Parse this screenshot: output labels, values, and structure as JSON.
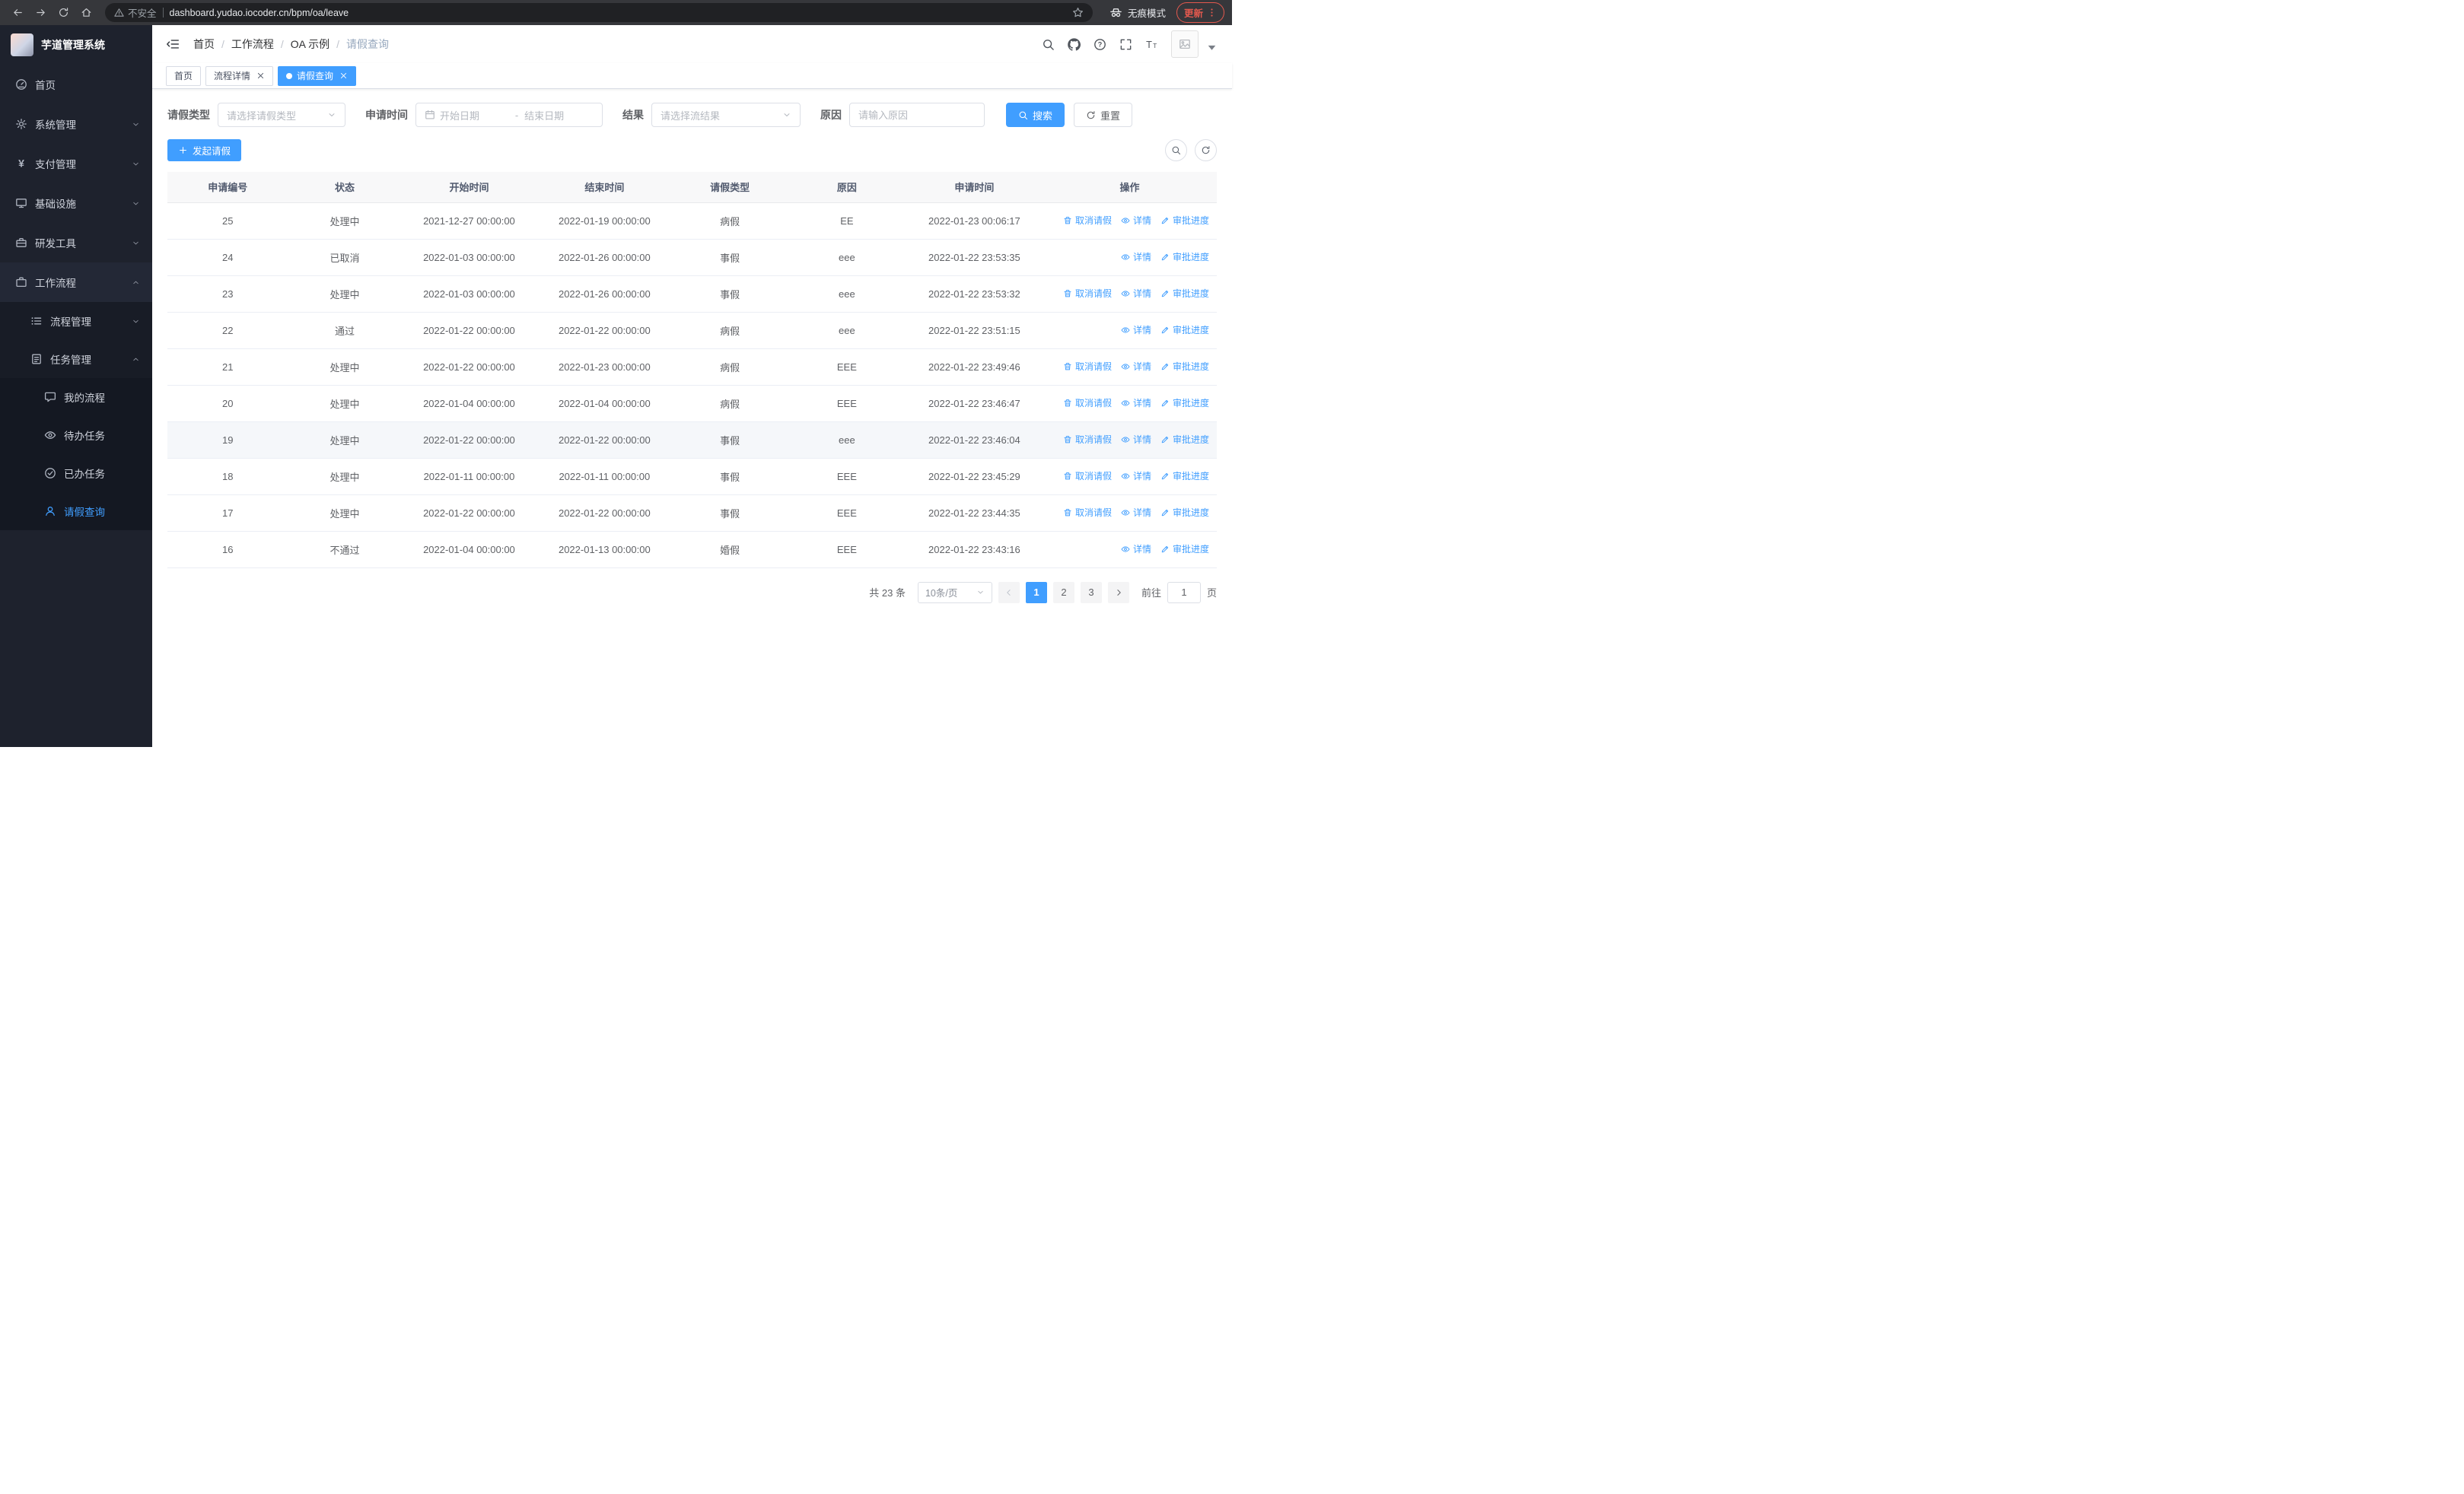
{
  "browser": {
    "security_label": "不安全",
    "url": "dashboard.yudao.iocoder.cn/bpm/oa/leave",
    "incognito_label": "无痕模式",
    "update_label": "更新"
  },
  "sidebar": {
    "logo_title": "芋道管理系统",
    "menu": [
      {
        "key": "home",
        "icon": "dashboard",
        "label": "首页",
        "level": 1
      },
      {
        "key": "system-management",
        "icon": "gear",
        "label": "系统管理",
        "level": 1,
        "arrow": "down"
      },
      {
        "key": "payment-management",
        "icon": "yen",
        "label": "支付管理",
        "level": 1,
        "arrow": "down"
      },
      {
        "key": "infrastructure",
        "icon": "monitor",
        "label": "基础设施",
        "level": 1,
        "arrow": "down"
      },
      {
        "key": "dev-tools",
        "icon": "toolbox",
        "label": "研发工具",
        "level": 1,
        "arrow": "down"
      },
      {
        "key": "workflow",
        "icon": "suitcase",
        "label": "工作流程",
        "level": 1,
        "arrow": "up",
        "parent_active": true
      },
      {
        "key": "process-management",
        "icon": "list",
        "label": "流程管理",
        "level": 2,
        "arrow": "down"
      },
      {
        "key": "task-management",
        "icon": "tasks",
        "label": "任务管理",
        "level": 2,
        "arrow": "up"
      },
      {
        "key": "my-process",
        "icon": "chat",
        "label": "我的流程",
        "level": 3
      },
      {
        "key": "todo-tasks",
        "icon": "eye",
        "label": "待办任务",
        "level": 3
      },
      {
        "key": "done-tasks",
        "icon": "check",
        "label": "已办任务",
        "level": 3
      },
      {
        "key": "leave-query",
        "icon": "user",
        "label": "请假查询",
        "level": 3,
        "active": true
      }
    ]
  },
  "breadcrumb": {
    "separator": "/",
    "items": [
      "首页",
      "工作流程",
      "OA 示例",
      "请假查询"
    ]
  },
  "tabs": [
    {
      "label": "首页",
      "closable": false,
      "active": false
    },
    {
      "label": "流程详情",
      "closable": true,
      "active": false
    },
    {
      "label": "请假查询",
      "closable": true,
      "active": true
    }
  ],
  "filters": {
    "leave_type": {
      "label": "请假类型",
      "placeholder": "请选择请假类型"
    },
    "apply_time": {
      "label": "申请时间",
      "start_placeholder": "开始日期",
      "separator": "-",
      "end_placeholder": "结束日期"
    },
    "result": {
      "label": "结果",
      "placeholder": "请选择流结果"
    },
    "reason": {
      "label": "原因",
      "placeholder": "请输入原因"
    },
    "search_label": "搜索",
    "reset_label": "重置"
  },
  "toolbar": {
    "create_label": "发起请假"
  },
  "table": {
    "columns": [
      "申请编号",
      "状态",
      "开始时间",
      "结束时间",
      "请假类型",
      "原因",
      "申请时间",
      "操作"
    ],
    "action_labels": {
      "cancel": "取消请假",
      "detail": "详情",
      "progress": "审批进度"
    },
    "rows": [
      {
        "id": "25",
        "status": "处理中",
        "start": "2021-12-27 00:00:00",
        "end": "2022-01-19 00:00:00",
        "type": "病假",
        "reason": "EE",
        "applied": "2022-01-23 00:06:17",
        "actions": [
          "cancel",
          "detail",
          "progress"
        ],
        "highlighted": false
      },
      {
        "id": "24",
        "status": "已取消",
        "start": "2022-01-03 00:00:00",
        "end": "2022-01-26 00:00:00",
        "type": "事假",
        "reason": "eee",
        "applied": "2022-01-22 23:53:35",
        "actions": [
          "detail",
          "progress"
        ],
        "highlighted": false
      },
      {
        "id": "23",
        "status": "处理中",
        "start": "2022-01-03 00:00:00",
        "end": "2022-01-26 00:00:00",
        "type": "事假",
        "reason": "eee",
        "applied": "2022-01-22 23:53:32",
        "actions": [
          "cancel",
          "detail",
          "progress"
        ],
        "highlighted": false
      },
      {
        "id": "22",
        "status": "通过",
        "start": "2022-01-22 00:00:00",
        "end": "2022-01-22 00:00:00",
        "type": "病假",
        "reason": "eee",
        "applied": "2022-01-22 23:51:15",
        "actions": [
          "detail",
          "progress"
        ],
        "highlighted": false
      },
      {
        "id": "21",
        "status": "处理中",
        "start": "2022-01-22 00:00:00",
        "end": "2022-01-23 00:00:00",
        "type": "病假",
        "reason": "EEE",
        "applied": "2022-01-22 23:49:46",
        "actions": [
          "cancel",
          "detail",
          "progress"
        ],
        "highlighted": false
      },
      {
        "id": "20",
        "status": "处理中",
        "start": "2022-01-04 00:00:00",
        "end": "2022-01-04 00:00:00",
        "type": "病假",
        "reason": "EEE",
        "applied": "2022-01-22 23:46:47",
        "actions": [
          "cancel",
          "detail",
          "progress"
        ],
        "highlighted": false
      },
      {
        "id": "19",
        "status": "处理中",
        "start": "2022-01-22 00:00:00",
        "end": "2022-01-22 00:00:00",
        "type": "事假",
        "reason": "eee",
        "applied": "2022-01-22 23:46:04",
        "actions": [
          "cancel",
          "detail",
          "progress"
        ],
        "highlighted": true
      },
      {
        "id": "18",
        "status": "处理中",
        "start": "2022-01-11 00:00:00",
        "end": "2022-01-11 00:00:00",
        "type": "事假",
        "reason": "EEE",
        "applied": "2022-01-22 23:45:29",
        "actions": [
          "cancel",
          "detail",
          "progress"
        ],
        "highlighted": false
      },
      {
        "id": "17",
        "status": "处理中",
        "start": "2022-01-22 00:00:00",
        "end": "2022-01-22 00:00:00",
        "type": "事假",
        "reason": "EEE",
        "applied": "2022-01-22 23:44:35",
        "actions": [
          "cancel",
          "detail",
          "progress"
        ],
        "highlighted": false
      },
      {
        "id": "16",
        "status": "不通过",
        "start": "2022-01-04 00:00:00",
        "end": "2022-01-13 00:00:00",
        "type": "婚假",
        "reason": "EEE",
        "applied": "2022-01-22 23:43:16",
        "actions": [
          "detail",
          "progress"
        ],
        "highlighted": false
      }
    ]
  },
  "pagination": {
    "total_label": "共 23 条",
    "page_size_label": "10条/页",
    "pages": [
      "1",
      "2",
      "3"
    ],
    "active_page": "1",
    "goto_label": "前往",
    "goto_value": "1",
    "goto_suffix": "页"
  },
  "colors": {
    "primary": "#409eff",
    "sidebar_bg": "#1e222d",
    "update_red": "#e4594e"
  }
}
